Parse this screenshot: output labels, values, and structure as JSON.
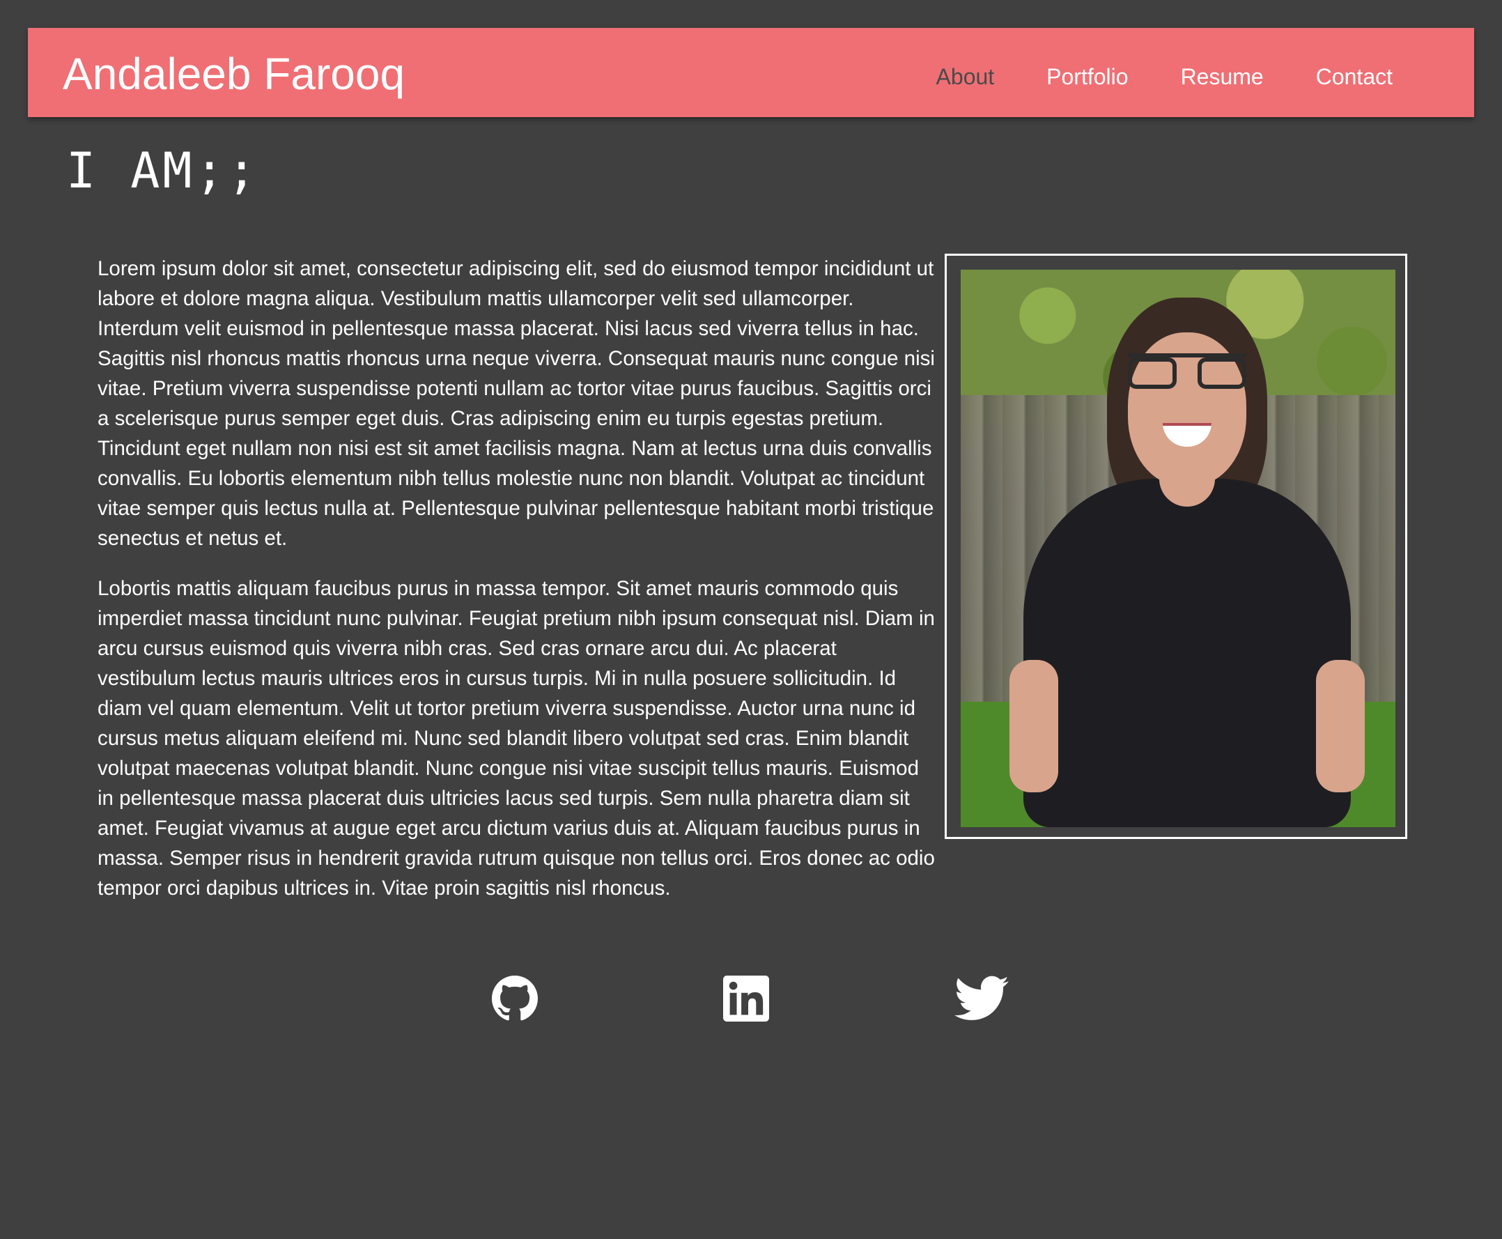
{
  "header": {
    "title": "Andaleeb Farooq",
    "nav": [
      {
        "label": "About",
        "active": true
      },
      {
        "label": "Portfolio",
        "active": false
      },
      {
        "label": "Resume",
        "active": false
      },
      {
        "label": "Contact",
        "active": false
      }
    ]
  },
  "main": {
    "heading": "I AM;;",
    "paragraphs": [
      "Lorem ipsum dolor sit amet, consectetur adipiscing elit, sed do eiusmod tempor incididunt ut labore et dolore magna aliqua. Vestibulum mattis ullamcorper velit sed ullamcorper. Interdum velit euismod in pellentesque massa placerat. Nisi lacus sed viverra tellus in hac. Sagittis nisl rhoncus mattis rhoncus urna neque viverra. Consequat mauris nunc congue nisi vitae. Pretium viverra suspendisse potenti nullam ac tortor vitae purus faucibus. Sagittis orci a scelerisque purus semper eget duis. Cras adipiscing enim eu turpis egestas pretium. Tincidunt eget nullam non nisi est sit amet facilisis magna. Nam at lectus urna duis convallis convallis. Eu lobortis elementum nibh tellus molestie nunc non blandit. Volutpat ac tincidunt vitae semper quis lectus nulla at. Pellentesque pulvinar pellentesque habitant morbi tristique senectus et netus et.",
      "Lobortis mattis aliquam faucibus purus in massa tempor. Sit amet mauris commodo quis imperdiet massa tincidunt nunc pulvinar. Feugiat pretium nibh ipsum consequat nisl. Diam in arcu cursus euismod quis viverra nibh cras. Sed cras ornare arcu dui. Ac placerat vestibulum lectus mauris ultrices eros in cursus turpis. Mi in nulla posuere sollicitudin. Id diam vel quam elementum. Velit ut tortor pretium viverra suspendisse. Auctor urna nunc id cursus metus aliquam eleifend mi. Nunc sed blandit libero volutpat sed cras. Enim blandit volutpat maecenas volutpat blandit. Nunc congue nisi vitae suscipit tellus mauris. Euismod in pellentesque massa placerat duis ultricies lacus sed turpis. Sem nulla pharetra diam sit amet. Feugiat vivamus at augue eget arcu dictum varius duis at. Aliquam faucibus purus in massa. Semper risus in hendrerit gravida rutrum quisque non tellus orci. Eros donec ac odio tempor orci dapibus ultrices in. Vitae proin sagittis nisl rhoncus."
    ]
  },
  "social": [
    {
      "icon": "github-icon"
    },
    {
      "icon": "linkedin-icon"
    },
    {
      "icon": "twitter-icon"
    }
  ],
  "colors": {
    "background": "#404040",
    "header": "#ef6f74",
    "active_nav": "#4a4a4a",
    "text": "#ffffff"
  }
}
